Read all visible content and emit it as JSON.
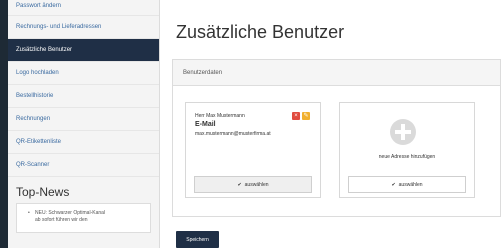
{
  "sidebar": {
    "items": [
      {
        "label": "Passwort ändern"
      },
      {
        "label": "Rechnungs- und Lieferadressen"
      },
      {
        "label": "Zusätzliche Benutzer"
      },
      {
        "label": "Logo hochladen"
      },
      {
        "label": "Bestellhistorie"
      },
      {
        "label": "Rechnungen"
      },
      {
        "label": "QR-Etikettenliste"
      },
      {
        "label": "QR-Scanner"
      }
    ],
    "active_index": 2
  },
  "news": {
    "title": "Top-News",
    "item_line1": "NEU: Schwarzer Optimal-Kanal",
    "item_line2": "ab sofort führen wir den"
  },
  "main": {
    "title": "Zusätzliche Benutzer",
    "panel_title": "Benutzerdaten",
    "user_card": {
      "name": "Herr Max Mustermann",
      "role": "E-Mail",
      "email": "max.mustermann@musterfirma.at",
      "select_label": "auswählen"
    },
    "add_card": {
      "label": "neue Adresse hinzufügen",
      "select_label": "auswählen"
    },
    "save_label": "Speichern"
  },
  "colors": {
    "active_nav": "#1f2f46",
    "link": "#3a6aa0",
    "delete_icon": "#e04b3f",
    "edit_icon": "#f1b02f",
    "outer_background": "#1e2a35"
  }
}
